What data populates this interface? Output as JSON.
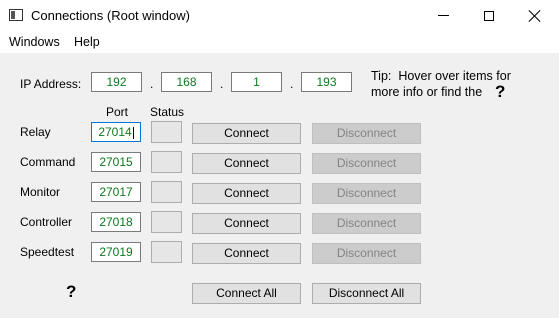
{
  "window": {
    "title": "Connections (Root window)"
  },
  "menu": {
    "windows": "Windows",
    "help": "Help"
  },
  "ip": {
    "label": "IP Address:",
    "octets": [
      "192",
      "168",
      "1",
      "193"
    ],
    "separator": "."
  },
  "tip": {
    "prefix": "Tip:",
    "line1": "Hover over items for",
    "line2": "more info or find the",
    "help_icon": "question-mark"
  },
  "columns": {
    "port": "Port",
    "status": "Status"
  },
  "rows": [
    {
      "name": "Relay",
      "port": "27014",
      "connect": "Connect",
      "disconnect": "Disconnect"
    },
    {
      "name": "Command",
      "port": "27015",
      "connect": "Connect",
      "disconnect": "Disconnect"
    },
    {
      "name": "Monitor",
      "port": "27017",
      "connect": "Connect",
      "disconnect": "Disconnect"
    },
    {
      "name": "Controller",
      "port": "27018",
      "connect": "Connect",
      "disconnect": "Disconnect"
    },
    {
      "name": "Speedtest",
      "port": "27019",
      "connect": "Connect",
      "disconnect": "Disconnect"
    }
  ],
  "footer": {
    "connect_all": "Connect All",
    "disconnect_all": "Disconnect All",
    "help_icon": "question-mark"
  },
  "colors": {
    "field_text": "#0a7a1c",
    "disabled_button": "#cccccc"
  }
}
